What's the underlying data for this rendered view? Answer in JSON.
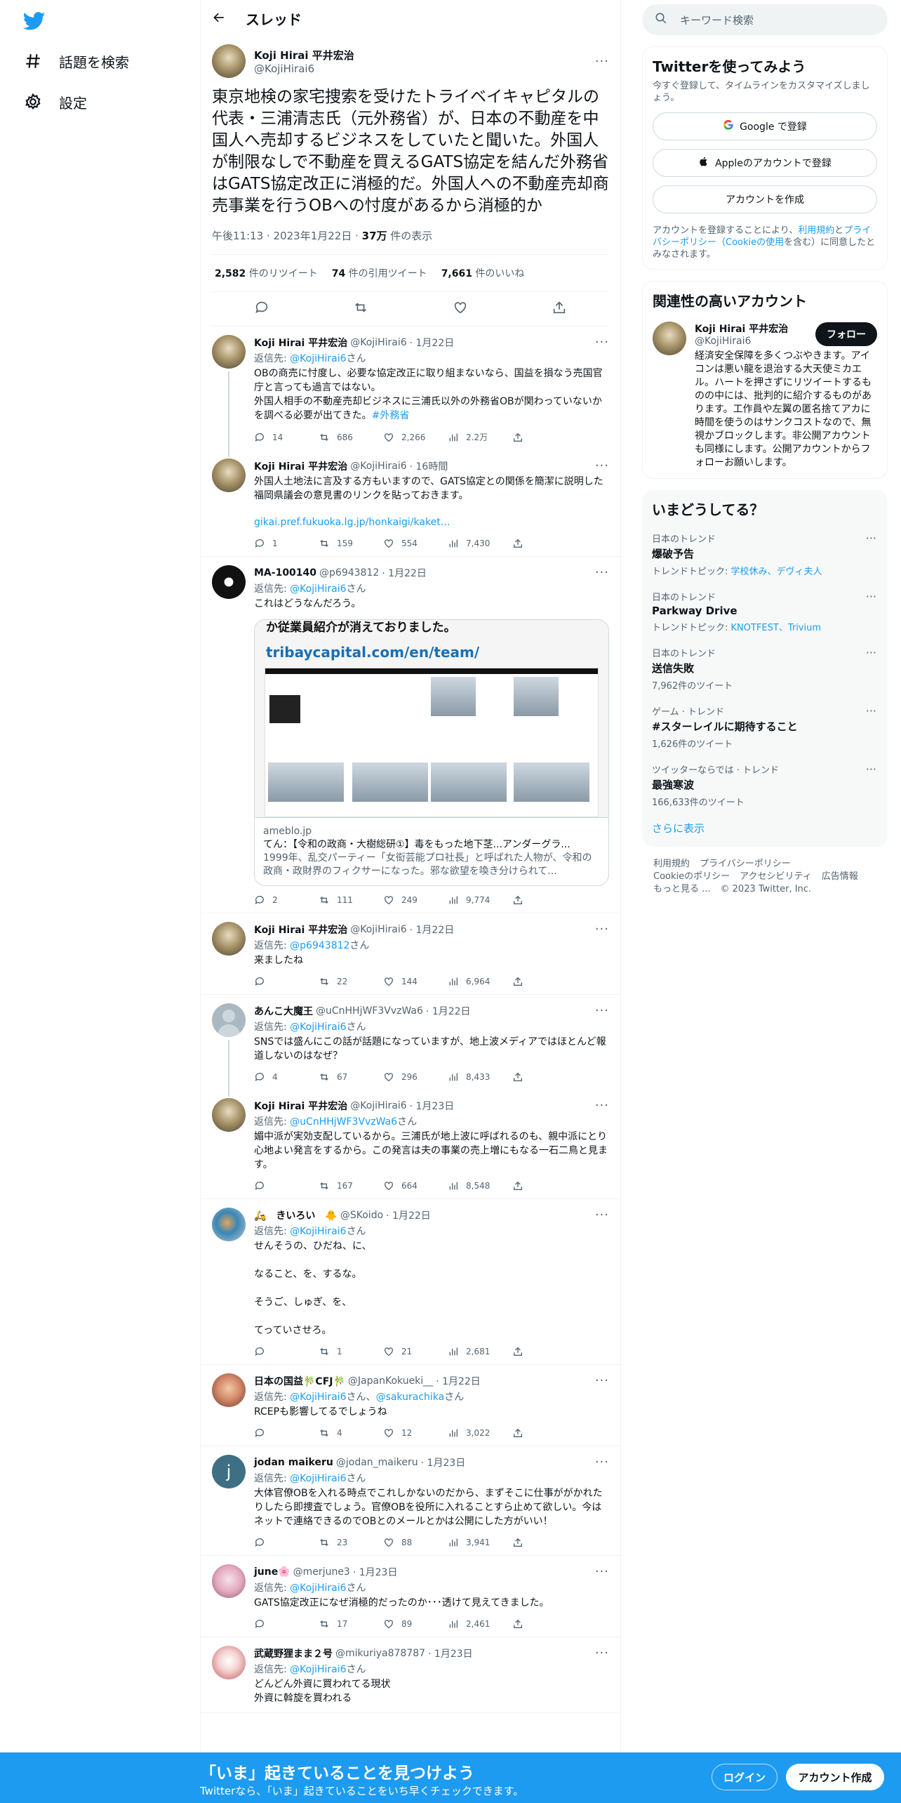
{
  "nav": {
    "explore_label": "話題を検索",
    "settings_label": "設定"
  },
  "main": {
    "header_title": "スレッド",
    "focal": {
      "name": "Koji Hirai 平井宏治",
      "handle": "@KojiHirai6",
      "text": "東京地検の家宅捜索を受けたトライベイキャピタルの代表・三浦清志氏（元外務省）が、日本の不動産を中国人へ売却するビジネスをしていたと聞いた。外国人が制限なしで不動産を買えるGATS協定を結んだ外務省はGATS協定改正に消極的だ。外国人への不動産売却商売事業を行うOBへの忖度があるから消極的か",
      "time": "午後11:13 · 2023年1月22日 · ",
      "views_count": "37万",
      "views_label": " 件の表示",
      "retweets": "2,582",
      "retweets_label": " 件のリツイート",
      "quotes": "74",
      "quotes_label": " 件の引用ツイート",
      "likes": "7,661",
      "likes_label": " 件のいいね"
    },
    "tweets": [
      {
        "name": "Koji Hirai 平井宏治",
        "handle": "@KojiHirai6",
        "date": "· 1月22日",
        "reply_to": "@KojiHirai6",
        "reply_suffix": "さん",
        "text": "OBの商売に忖度し、必要な協定改正に取り組まないなら、国益を損なう売国官庁と言っても過言ではない。\n外国人相手の不動産売却ビジネスに三浦氏以外の外務省OBが関わっていないかを調べる必要が出てきた。",
        "hashtag": "#外務省",
        "replies": "14",
        "retweets": "686",
        "likes": "2,266",
        "views": "2.2万"
      },
      {
        "name": "Koji Hirai 平井宏治",
        "handle": "@KojiHirai6",
        "date": "· 16時間",
        "text": "外国人土地法に言及する方もいますので、GATS協定との関係を簡潔に説明した福岡県議会の意見書のリンクを貼っておきます。",
        "link": "gikai.pref.fukuoka.lg.jp/honkaigi/kaket…",
        "replies": "1",
        "retweets": "159",
        "likes": "554",
        "views": "7,430"
      },
      {
        "name": "MA-100140",
        "handle": "@p6943812",
        "date": "· 1月22日",
        "reply_to": "@KojiHirai6",
        "reply_suffix": "さん",
        "text": "これはどうなんだろう。",
        "card": {
          "headline": "か従業員紹介が消えておりました。",
          "url": "tribaycapital.com/en/team/",
          "domain": "ameblo.jp",
          "title": "てん：【令和の政商・大樹総研①】毒をもった地下茎...アンダーグラ...",
          "desc": "1999年、乱交パーティー「女衒芸能プロ社長」と呼ばれた人物が、令和の政商・政財界のフィクサーになった。邪な欲望を喚き分けられて..."
        },
        "replies": "2",
        "retweets": "111",
        "likes": "249",
        "views": "9,774"
      },
      {
        "name": "Koji Hirai 平井宏治",
        "handle": "@KojiHirai6",
        "date": "· 1月22日",
        "reply_to": "@p6943812",
        "reply_suffix": "さん",
        "text": "来ましたね",
        "replies": "",
        "retweets": "22",
        "likes": "144",
        "views": "6,964"
      },
      {
        "name": "あんこ大魔王",
        "handle": "@uCnHHjWF3VvzWa6",
        "date": "· 1月22日",
        "reply_to": "@KojiHirai6",
        "reply_suffix": "さん",
        "text": "SNSでは盛んにこの話が話題になっていますが、地上波メディアではほとんど報道しないのはなぜ？",
        "replies": "4",
        "retweets": "67",
        "likes": "296",
        "views": "8,433"
      },
      {
        "name": "Koji Hirai 平井宏治",
        "handle": "@KojiHirai6",
        "date": "· 1月23日",
        "reply_to": "@uCnHHjWF3VvzWa6",
        "reply_suffix": "さん",
        "text": "媚中派が実効支配しているから。三浦氏が地上波に呼ばれるのも、親中派にとり心地よい発言をするから。この発言は夫の事業の売上増にもなる一石二鳥と見ます。",
        "replies": "",
        "retweets": "167",
        "likes": "664",
        "views": "8,548"
      },
      {
        "name": "🛵　きいろい　🐥",
        "handle": "@SKoido",
        "date": "· 1月22日",
        "reply_to": "@KojiHirai6",
        "reply_suffix": "さん",
        "text": "せんそうの、ひだね、に、\n\nなること、を、するな。\n\nそうご、しゅぎ、を、\n\nてっていさせろ。",
        "replies": "",
        "retweets": "1",
        "likes": "21",
        "views": "2,681"
      },
      {
        "name": "日本の国益🎋CFJ🎋",
        "handle": "@JapanKokueki__",
        "date": "· 1月22日",
        "reply_to": "@KojiHirai6",
        "reply_mid": "さん、",
        "reply_to2": "@sakurachika",
        "reply_suffix": "さん",
        "text": "RCEPも影響してるでしょうね",
        "replies": "",
        "retweets": "4",
        "likes": "12",
        "views": "3,022"
      },
      {
        "name": "jodan maikeru",
        "handle": "@jodan_maikeru",
        "date": "· 1月23日",
        "reply_to": "@KojiHirai6",
        "reply_suffix": "さん",
        "text": "大体官僚OBを入れる時点でこれしかないのだから、まずそこに仕事ががかれたりしたら即捜査でしょう。官僚OBを役所に入れることすら止めて欲しい。今はネットで連絡できるのでOBとのメールとかは公開にした方がいい！",
        "avatar_letter": "j",
        "replies": "",
        "retweets": "23",
        "likes": "88",
        "views": "3,941"
      },
      {
        "name": "june🌸",
        "handle": "@merjune3",
        "date": "· 1月23日",
        "reply_to": "@KojiHirai6",
        "reply_suffix": "さん",
        "text": "GATS協定改正になぜ消極的だったのか･･･透けて見えてきました。",
        "replies": "",
        "retweets": "17",
        "likes": "89",
        "views": "2,461"
      },
      {
        "name": "武蔵野狸まま２号",
        "handle": "@mikuriya878787",
        "date": "· 1月23日",
        "reply_to": "@KojiHirai6",
        "reply_suffix": "さん",
        "text": "どんどん外資に買われてる現状\n外資に斡旋を買われる"
      }
    ]
  },
  "sidebar": {
    "search_placeholder": "キーワード検索",
    "signup": {
      "title": "Twitterを使ってみよう",
      "subtitle": "今すぐ登録して、タイムラインをカスタマイズしましょう。",
      "google_label": "Google で登録",
      "apple_label": "Appleのアカウントで登録",
      "create_label": "アカウントを作成",
      "legal_prefix": "アカウントを登録することにより、",
      "legal_terms": "利用規約",
      "legal_and": "と",
      "legal_privacy": "プライバシーポリシー（Cookieの使用",
      "legal_suffix": "を含む）に同意したとみなされます。"
    },
    "related": {
      "title": "関連性の高いアカウント",
      "name": "Koji Hirai 平井宏治",
      "handle": "@KojiHirai6",
      "follow_label": "フォロー",
      "bio": "経済安全保障を多くつぶやきます。アイコンは悪い龍を退治する大天使ミカエル。ハートを押さずにリツイートするものの中には、批判的に紹介するものがあります。工作員や左翼の匿名捨てアカに時間を使うのはサンクコストなので、無視かブロックします。非公開アカウントも同様にします。公開アカウントからフォローお願いします。"
    },
    "trends": {
      "title": "いまどうしてる？",
      "items": [
        {
          "category": "日本のトレンド",
          "name": "爆破予告",
          "topic_label": "トレンドトピック: ",
          "topic": "学校休み、デヴィ夫人"
        },
        {
          "category": "日本のトレンド",
          "name": "Parkway Drive",
          "topic_label": "トレンドトピック: ",
          "topic": "KNOTFEST、Trivium"
        },
        {
          "category": "日本のトレンド",
          "name": "送信失敗",
          "count": "7,962件のツイート"
        },
        {
          "category": "ゲーム · トレンド",
          "name": "#スターレイルに期待すること",
          "count": "1,626件のツイート"
        },
        {
          "category": "ツイッターならでは · トレンド",
          "name": "最強寒波",
          "count": "166,633件のツイート"
        }
      ],
      "show_more": "さらに表示"
    },
    "footer": {
      "line1": [
        "利用規約",
        "プライバシーポリシー"
      ],
      "line2": [
        "Cookieのポリシー",
        "アクセシビリティ",
        "広告情報"
      ],
      "line3": [
        "もっと見る ...",
        "© 2023 Twitter, Inc."
      ]
    }
  },
  "bottombar": {
    "title": "「いま」起きていることを見つけよう",
    "subtitle": "Twitterなら、「いま」起きていることをいち早くチェックできます。",
    "login_label": "ログイン",
    "signup_label": "アカウント作成"
  },
  "colors": {
    "accent": "#1d9bf0",
    "text": "#0f1419",
    "secondary": "#536471"
  }
}
